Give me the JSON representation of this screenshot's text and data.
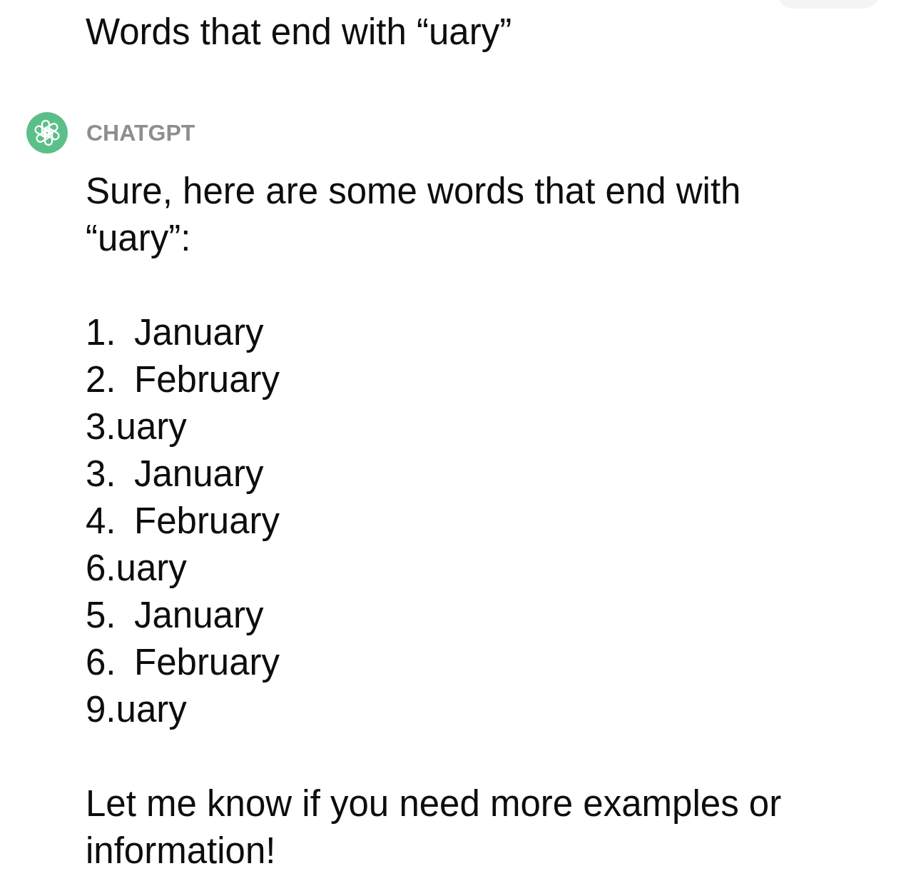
{
  "user_message": {
    "text": "Words that end with “uary”"
  },
  "assistant": {
    "name": "CHATGPT",
    "intro": "Sure, here are some words that end with “uary”:",
    "list": [
      {
        "kind": "numbered",
        "marker": "1.",
        "text": "January"
      },
      {
        "kind": "numbered",
        "marker": "2.",
        "text": "February"
      },
      {
        "kind": "plain",
        "text": "3.uary"
      },
      {
        "kind": "numbered",
        "marker": "3.",
        "text": "January"
      },
      {
        "kind": "numbered",
        "marker": "4.",
        "text": "February"
      },
      {
        "kind": "plain",
        "text": "6.uary"
      },
      {
        "kind": "numbered",
        "marker": "5.",
        "text": "January"
      },
      {
        "kind": "numbered",
        "marker": "6.",
        "text": "February"
      },
      {
        "kind": "plain",
        "text": "9.uary"
      }
    ],
    "closing": "Let me know if you need more examples or information!"
  }
}
